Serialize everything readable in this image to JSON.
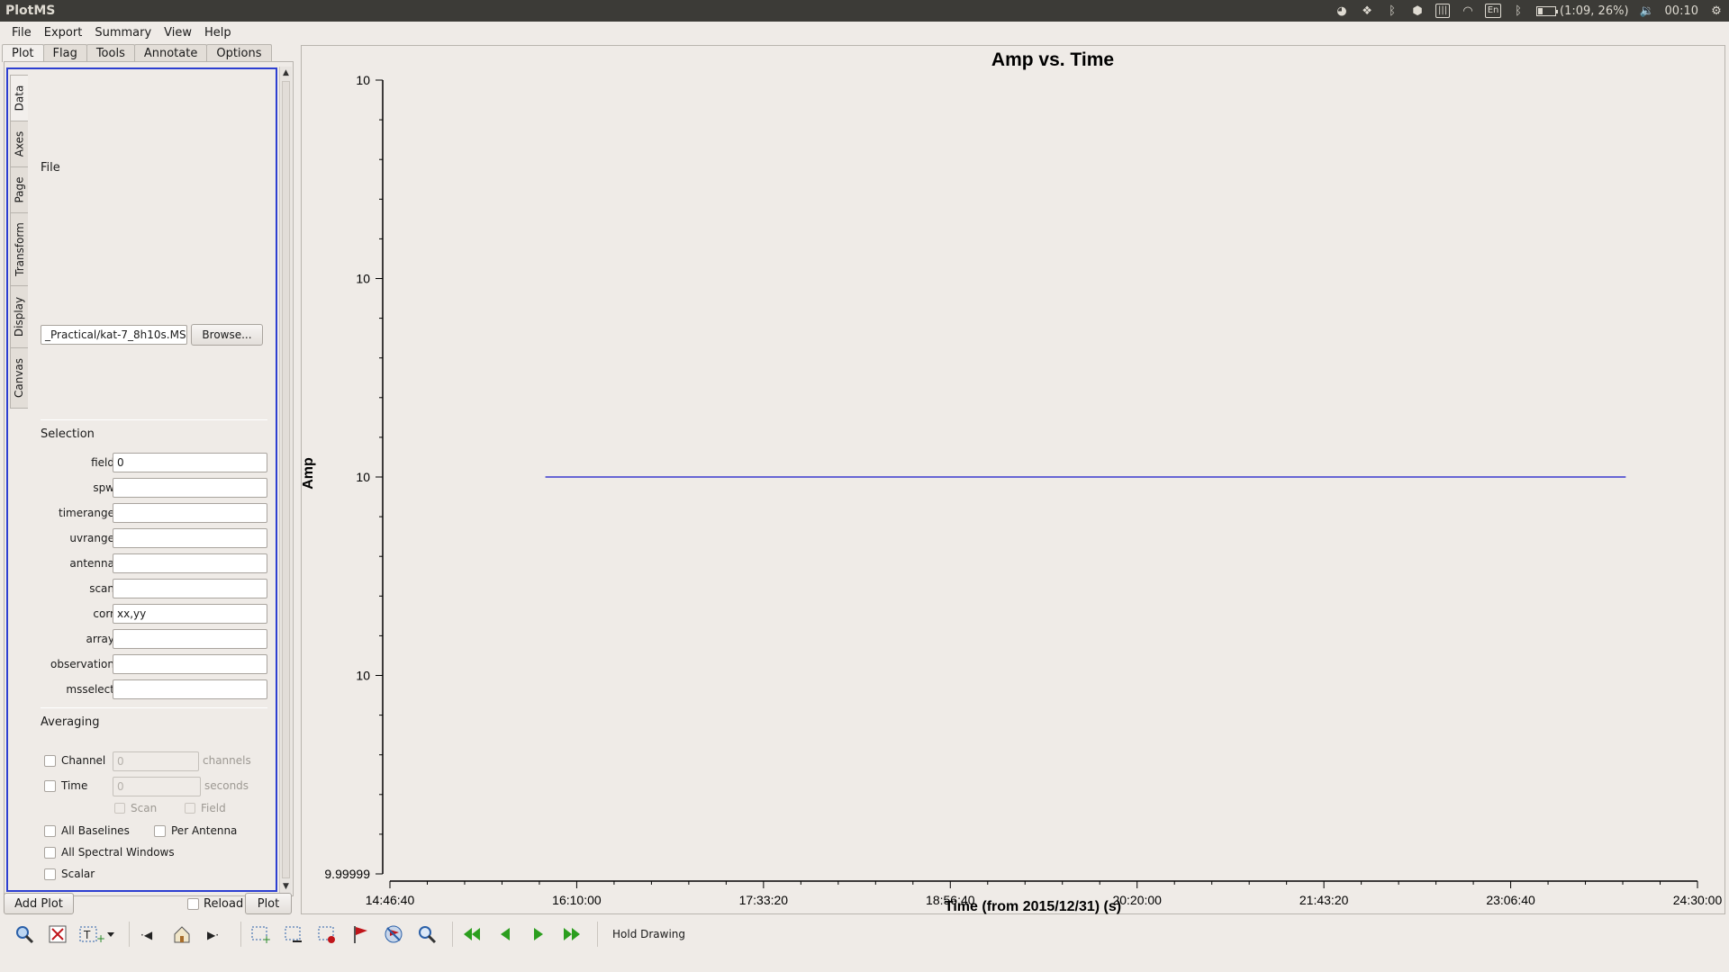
{
  "window": {
    "title": "PlotMS"
  },
  "tray": {
    "lang": "En",
    "battery": "(1:09, 26%)",
    "clock": "00:10",
    "icons": [
      "firefox-icon",
      "dropbox-icon",
      "bluetooth-icon",
      "steam-icon",
      "keyboard-icon",
      "wifi-icon",
      "language-icon",
      "bluetooth-icon",
      "battery-icon",
      "volume-icon",
      "settings-gear-icon"
    ]
  },
  "menu": [
    "File",
    "Export",
    "Summary",
    "View",
    "Help"
  ],
  "top_tabs": [
    "Plot",
    "Flag",
    "Tools",
    "Annotate",
    "Options"
  ],
  "side_tabs": [
    "Data",
    "Axes",
    "Page",
    "Transform",
    "Display",
    "Canvas"
  ],
  "data_panel": {
    "file_label": "File",
    "file_value": "_Practical/kat-7_8h10s.MS",
    "browse": "Browse...",
    "selection_label": "Selection",
    "fields": [
      {
        "label": "field",
        "value": "0"
      },
      {
        "label": "spw",
        "value": ""
      },
      {
        "label": "timerange",
        "value": ""
      },
      {
        "label": "uvrange",
        "value": ""
      },
      {
        "label": "antenna",
        "value": ""
      },
      {
        "label": "scan",
        "value": ""
      },
      {
        "label": "corr",
        "value": "xx,yy"
      },
      {
        "label": "array",
        "value": ""
      },
      {
        "label": "observation",
        "value": ""
      },
      {
        "label": "msselect",
        "value": ""
      }
    ],
    "averaging_label": "Averaging",
    "avg_channel": {
      "label": "Channel",
      "value": "0",
      "unit": "channels"
    },
    "avg_time": {
      "label": "Time",
      "value": "0",
      "unit": "seconds"
    },
    "avg_scan": "Scan",
    "avg_field": "Field",
    "all_baselines": "All Baselines",
    "per_antenna": "Per Antenna",
    "all_spw": "All Spectral Windows",
    "scalar": "Scalar"
  },
  "bottom_buttons": {
    "add_plot": "Add Plot",
    "reload": "Reload",
    "plot": "Plot"
  },
  "toolbar": {
    "icons": [
      "zoom-icon",
      "pan-icon",
      "annotate-icon",
      "undo-icon",
      "home-icon",
      "redo-icon",
      "mark-region-icon",
      "subtract-region-icon",
      "clear-regions-icon",
      "flag-icon",
      "unflag-icon",
      "locate-icon",
      "first-iteration-icon",
      "previous-iteration-icon",
      "next-iteration-icon",
      "last-iteration-icon"
    ],
    "hold_drawing": "Hold Drawing"
  },
  "chart_data": {
    "type": "line",
    "title": "Amp vs. Time",
    "xlabel": "Time (from 2015/12/31) (s)",
    "ylabel": "Amp",
    "x_ticks": [
      "14:46:40",
      "16:10:00",
      "17:33:20",
      "18:56:40",
      "20:20:00",
      "21:43:20",
      "23:06:40",
      "24:30:00"
    ],
    "y_ticks": [
      "10",
      "10",
      "10",
      "10",
      "9.99999"
    ],
    "xlim": [
      "14:46:40",
      "24:30:00"
    ],
    "ylim": [
      9.99999,
      10
    ],
    "series": [
      {
        "color": "#3a3acf",
        "x": [
          "15:56:00",
          "23:58:00"
        ],
        "values": [
          10,
          10
        ]
      }
    ],
    "grid": false
  }
}
